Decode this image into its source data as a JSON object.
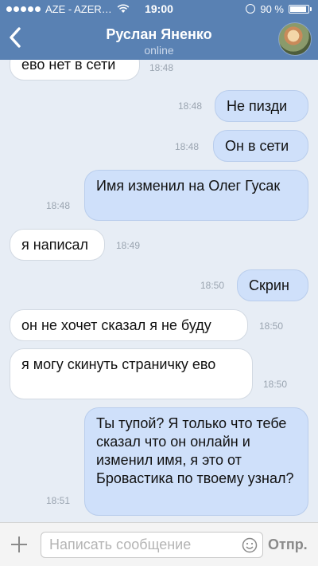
{
  "status_bar": {
    "carrier": "AZE - AZER…",
    "time": "19:00",
    "battery": "90 %",
    "battery_level": 0.9
  },
  "header": {
    "back_icon": "chevron-left-icon",
    "title": "Руслан Яненко",
    "subtitle": "online"
  },
  "messages": [
    {
      "direction": "in",
      "text": "ево нет в сети",
      "time": "18:48"
    },
    {
      "direction": "out",
      "text": "Не пизди",
      "time": "18:48"
    },
    {
      "direction": "out",
      "text": "Он в сети",
      "time": "18:48"
    },
    {
      "direction": "out",
      "text": "Имя изменил на Олег Гусак",
      "time": "18:48"
    },
    {
      "direction": "in",
      "text": "я написал",
      "time": "18:49"
    },
    {
      "direction": "out",
      "text": "Скрин",
      "time": "18:50"
    },
    {
      "direction": "in",
      "text": "он не хочет сказал я не буду",
      "time": "18:50"
    },
    {
      "direction": "in",
      "text": "я могу скинуть страничку ево",
      "time": "18:50"
    },
    {
      "direction": "out",
      "text": "Ты тупой? Я только что тебе сказал что он онлайн и изменил имя, я это от Бровастика по твоему узнал?",
      "time": "18:51"
    }
  ],
  "composer": {
    "placeholder": "Написать сообщение",
    "value": "",
    "send_label": "Отпр."
  },
  "colors": {
    "header": "#5981b3",
    "chat_bg": "#e7edf5",
    "outgoing": "#cfe0fa",
    "incoming": "#ffffff"
  }
}
